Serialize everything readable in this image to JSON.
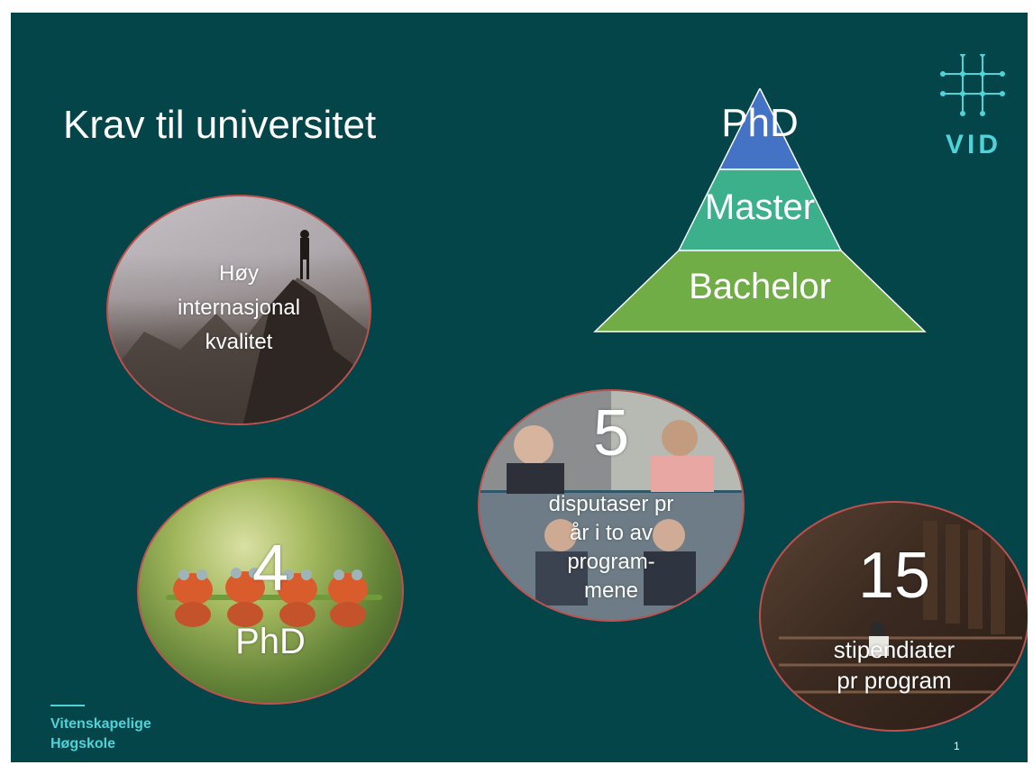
{
  "slide": {
    "title": "Krav til universitet",
    "logo": {
      "text": "VID",
      "icon": "grid-hash-icon"
    },
    "pyramid": [
      "PhD",
      "Master",
      "Bachelor"
    ],
    "ovals": {
      "quality": {
        "lines": [
          "Høy",
          "internasjonal",
          "kvalitet"
        ]
      },
      "phd": {
        "number": "4",
        "label": "PhD"
      },
      "disputaser": {
        "number": "5",
        "lines": [
          "disputaser pr",
          "år i to av",
          "program-",
          "mene"
        ]
      },
      "stipendiater": {
        "number": "15",
        "lines": [
          "stipendiater",
          "pr program"
        ]
      }
    },
    "footer": {
      "lines": [
        "Vitenskapelige",
        "Høgskole"
      ]
    },
    "page_number": "1"
  },
  "colors": {
    "background": "#034549",
    "pyramid_top": "#4472c4",
    "pyramid_middle": "#3cb08a",
    "pyramid_bottom": "#70ad47",
    "accent": "#4fd3d8",
    "oval_border": "#c0504d"
  }
}
